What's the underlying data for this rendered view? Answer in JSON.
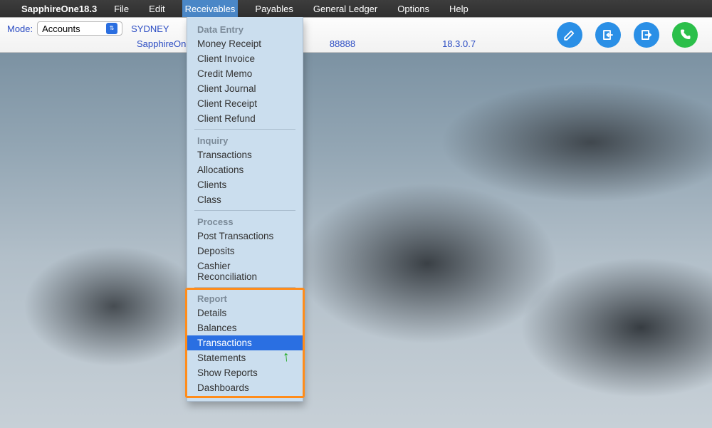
{
  "menubar": {
    "app_title": "SapphireOne18.3",
    "items": [
      "File",
      "Edit",
      "Receivables",
      "Payables",
      "General Ledger",
      "Options",
      "Help"
    ],
    "open_index": 2
  },
  "toolbar": {
    "mode_label": "Mode:",
    "mode_value": "Accounts",
    "location": "SYDNEY",
    "company": "SapphireOne S",
    "code": "88888",
    "version": "18.3.0.7"
  },
  "dropdown": {
    "sections": [
      {
        "header": "Data Entry",
        "items": [
          "Money Receipt",
          "Client Invoice",
          "Credit Memo",
          "Client Journal",
          "Client Receipt",
          "Client Refund"
        ]
      },
      {
        "header": "Inquiry",
        "items": [
          "Transactions",
          "Allocations",
          "Clients",
          "Class"
        ]
      },
      {
        "header": "Process",
        "items": [
          "Post Transactions",
          "Deposits",
          "Cashier Reconciliation"
        ]
      },
      {
        "header": "Report",
        "items": [
          "Details",
          "Balances",
          "Transactions",
          "Statements",
          "Show Reports",
          "Dashboards"
        ],
        "highlight_item_index": 2,
        "outlined": true
      }
    ]
  }
}
